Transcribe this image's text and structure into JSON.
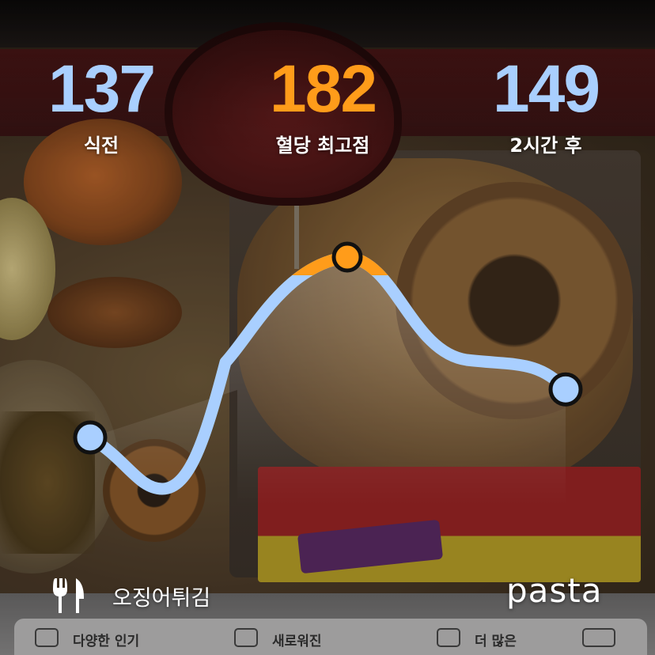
{
  "stats": [
    {
      "value": "137",
      "label": "식전",
      "color": "#a9cfff"
    },
    {
      "value": "182",
      "label": "혈당 최고점",
      "color": "#ff9c1a"
    },
    {
      "value": "149",
      "label": "2시간 후",
      "color": "#a9cfff"
    }
  ],
  "chart_data": {
    "type": "line",
    "series": [
      {
        "values": [
          137,
          182,
          149
        ]
      }
    ],
    "colors": {
      "line": "#a9cfff",
      "peak": "#ff9c1a",
      "marker_stroke": "#111111"
    }
  },
  "meal": {
    "icon": "fork-knife-icon",
    "name": "오징어튀김"
  },
  "brand": {
    "name": "pasta"
  }
}
